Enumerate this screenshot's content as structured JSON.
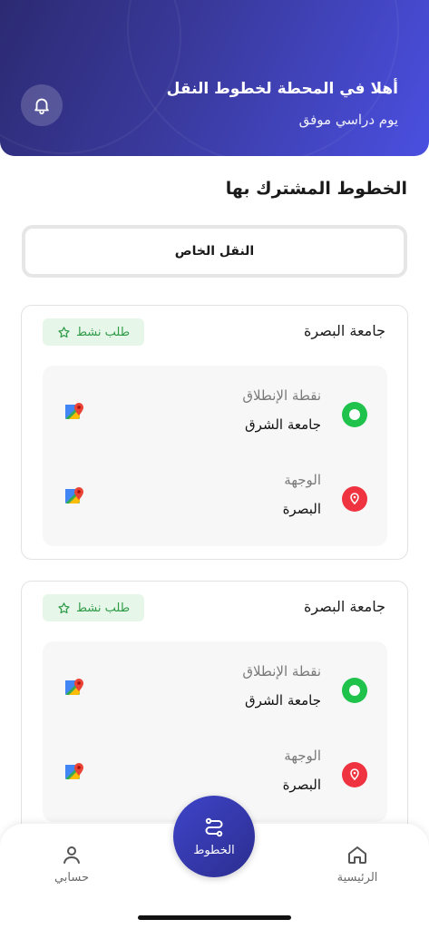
{
  "header": {
    "welcome": "أهلا في المحطة لخطوط النقل",
    "subtitle": "يوم دراسي موفق",
    "notification_icon": "bell-icon"
  },
  "section_title": "الخطوط المشترك بها",
  "filter": {
    "label": "النقل الخاص"
  },
  "routes": [
    {
      "title": "جامعة البصرة",
      "badge": "طلب نشط",
      "origin_label": "نقطة الإنطلاق",
      "origin_value": "جامعة الشرق",
      "destination_label": "الوجهة",
      "destination_value": "البصرة"
    },
    {
      "title": "جامعة البصرة",
      "badge": "طلب نشط",
      "origin_label": "نقطة الإنطلاق",
      "origin_value": "جامعة الشرق",
      "destination_label": "الوجهة",
      "destination_value": "البصرة"
    }
  ],
  "nav": {
    "home": "الرئيسية",
    "routes": "الخطوط",
    "account": "حسابي"
  },
  "colors": {
    "header_start": "#2c2a72",
    "header_end": "#4a4fe0",
    "origin_green": "#1fc24a",
    "destination_red": "#ef3340",
    "badge_green": "#2e9b47",
    "fab": "#3a3fc0"
  }
}
